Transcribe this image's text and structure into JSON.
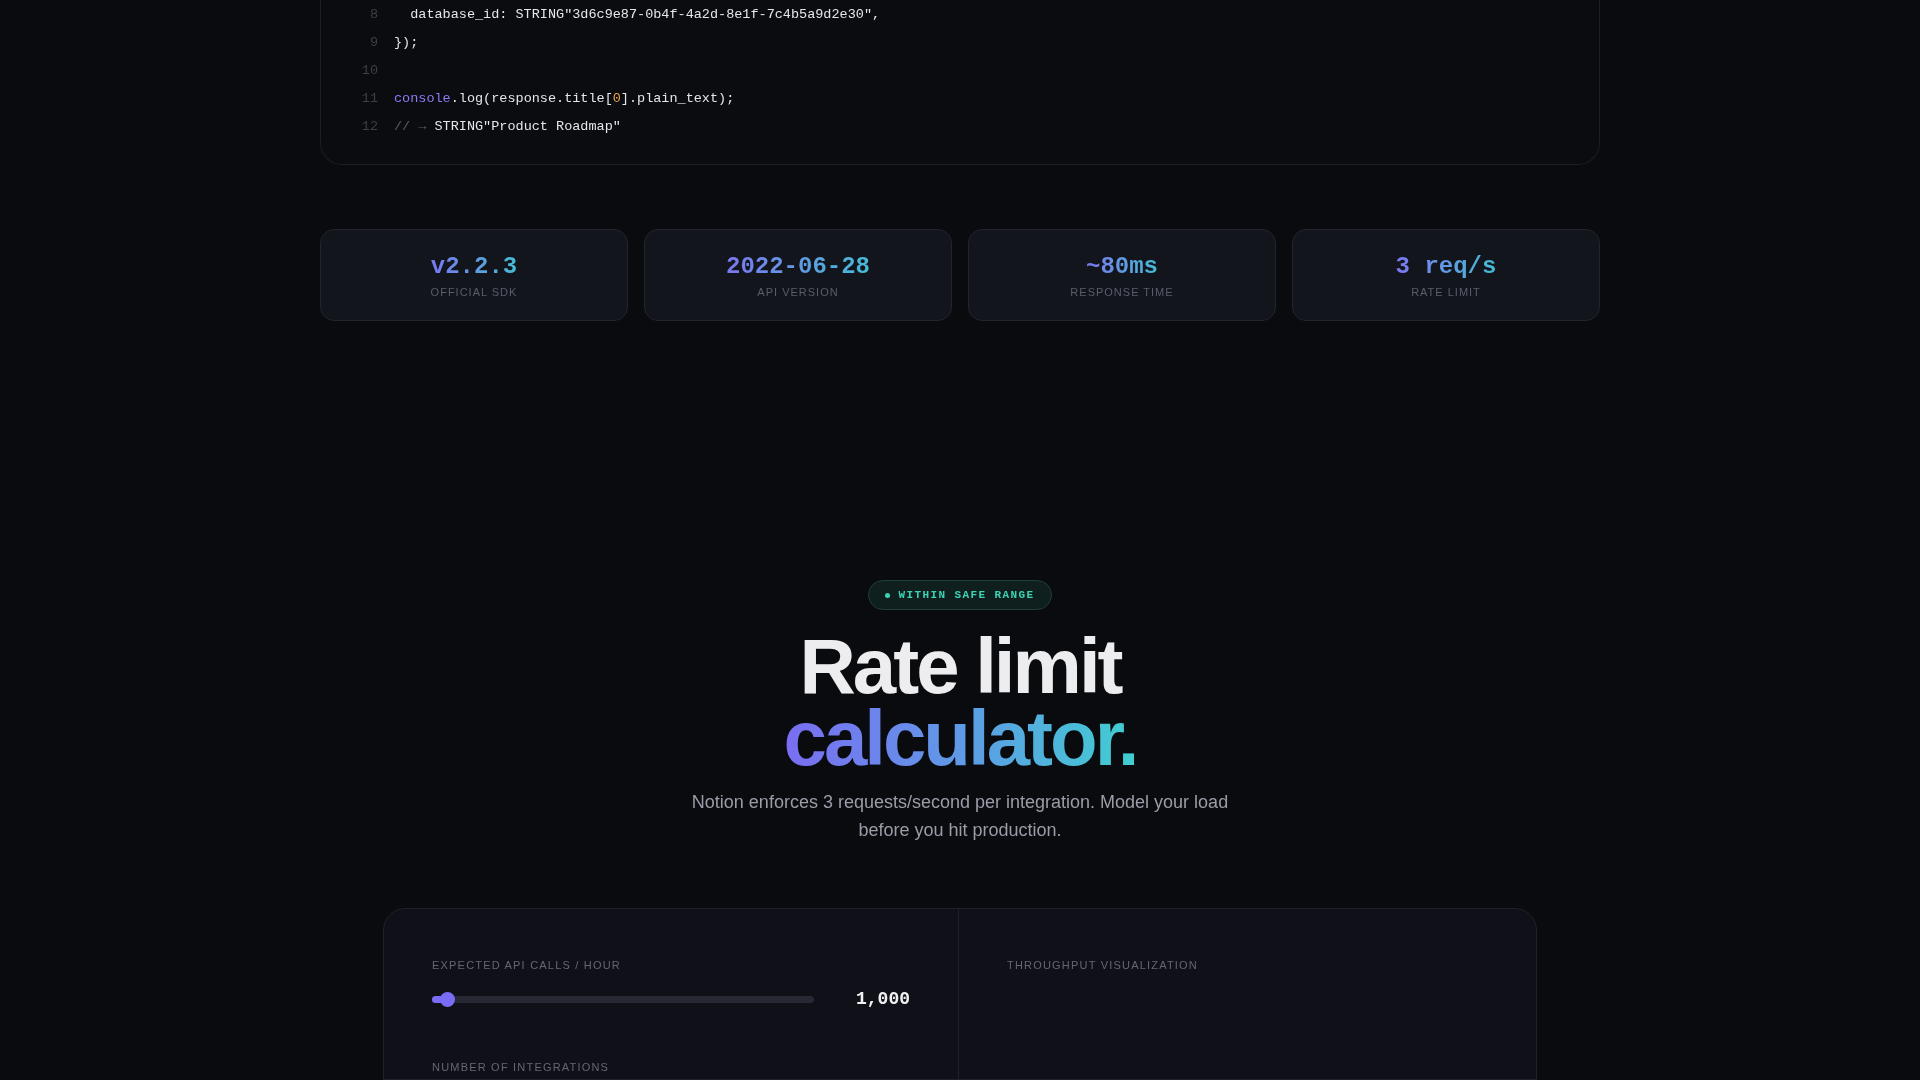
{
  "code_block": {
    "lines": [
      {
        "number": "8",
        "tokens": [
          {
            "kind": "plain",
            "text": "  database_id: STRING\"3d6c9e87-0b4f-4a2d-8e1f-7c4b5a9d2e30\","
          }
        ]
      },
      {
        "number": "9",
        "tokens": [
          {
            "kind": "plain",
            "text": "});"
          }
        ]
      },
      {
        "number": "10"
      },
      {
        "number": "11",
        "tokens": [
          {
            "kind": "keyword",
            "text": "console"
          },
          {
            "kind": "plain",
            "text": ".log(response.title["
          },
          {
            "kind": "number",
            "text": "0"
          },
          {
            "kind": "plain",
            "text": "].plain_text);"
          }
        ]
      },
      {
        "number": "12",
        "tokens": [
          {
            "kind": "comment",
            "text": "// → "
          },
          {
            "kind": "plain",
            "text": "STRING\"Product Roadmap\""
          }
        ]
      }
    ]
  },
  "stats": [
    {
      "value": "v2.2.3",
      "label": "OFFICIAL SDK"
    },
    {
      "value": "2022-06-28",
      "label": "API VERSION"
    },
    {
      "value": "~80ms",
      "label": "RESPONSE TIME"
    },
    {
      "value": "3 req/s",
      "label": "RATE LIMIT"
    }
  ],
  "calculator_section": {
    "badge": "WITHIN SAFE RANGE",
    "title_line_1": "Rate limit",
    "title_line_2": "calculator.",
    "subtitle": "Notion enforces 3 requests/second per integration. Model your load before you hit production.",
    "inputs_panel": {
      "slider": {
        "label": "EXPECTED API CALLS / HOUR",
        "level": 0.04,
        "reading": "1,000"
      },
      "next_label": "NUMBER OF INTEGRATIONS"
    },
    "visualization_panel": {
      "label": "THROUGHPUT VISUALIZATION"
    }
  }
}
